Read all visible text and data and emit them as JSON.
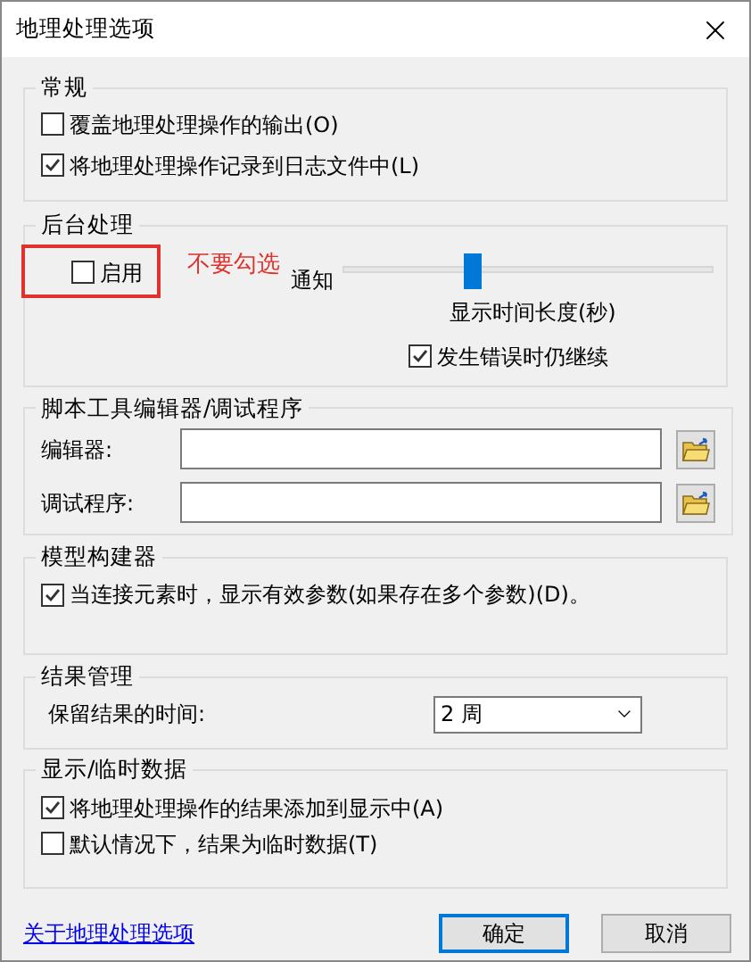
{
  "window": {
    "title": "地理处理选项"
  },
  "general": {
    "title": "常规",
    "options": [
      {
        "label": "覆盖地理处理操作的输出(O)",
        "checked": false
      },
      {
        "label": "将地理处理操作记录到日志文件中(L)",
        "checked": true
      }
    ]
  },
  "background": {
    "title": "后台处理",
    "enable": {
      "label": "启用",
      "checked": false
    },
    "annotation": "不要勾选",
    "slider": {
      "label": "通知",
      "level": 0.35,
      "caption": "显示时间长度(秒)"
    },
    "continue_on_error": {
      "label": "发生错误时仍继续",
      "checked": true
    }
  },
  "script_editor": {
    "title": "脚本工具编辑器/调试程序",
    "fields": [
      {
        "label": "编辑器:"
      },
      {
        "label": "调试程序:"
      }
    ]
  },
  "model_builder": {
    "title": "模型构建器",
    "options": [
      {
        "label": "当连接元素时，显示有效参数(如果存在多个参数)(D)。",
        "checked": true
      }
    ]
  },
  "results": {
    "title": "结果管理",
    "label": "保留结果的时间:",
    "value": "2 周"
  },
  "display": {
    "title": "显示/临时数据",
    "options": [
      {
        "label": "将地理处理操作的结果添加到显示中(A)",
        "checked": true
      },
      {
        "label": "默认情况下，结果为临时数据(T)",
        "checked": false
      }
    ]
  },
  "footer": {
    "link": "关于地理处理选项",
    "buttons": [
      {
        "label": "确定",
        "default": true
      },
      {
        "label": "取消",
        "default": false
      }
    ]
  }
}
